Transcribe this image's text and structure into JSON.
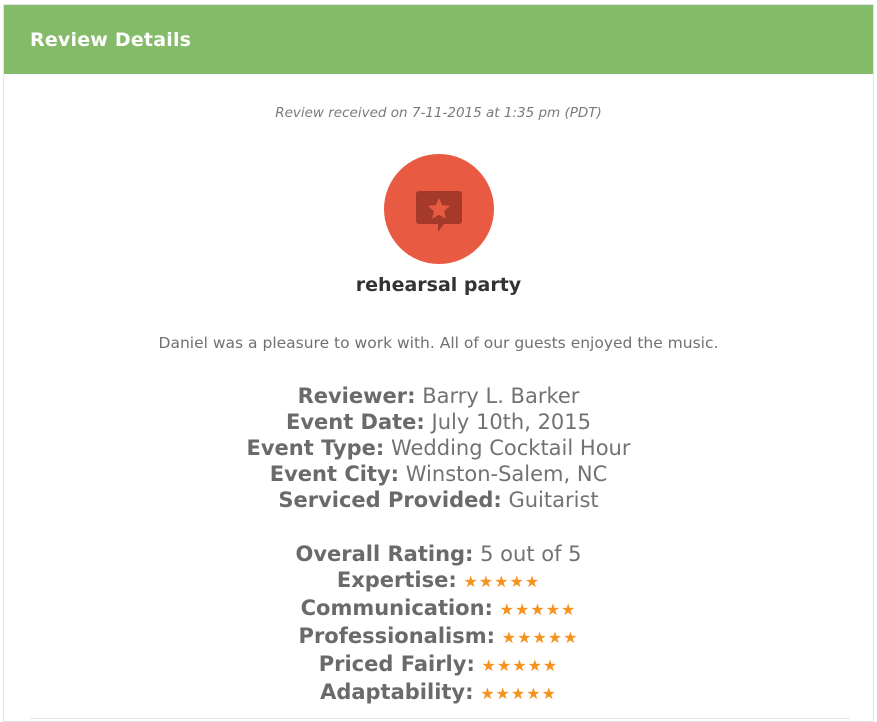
{
  "header": {
    "title": "Review Details",
    "background_color": "#84bb68"
  },
  "review": {
    "received": "Review received on 7-11-2015 at 1:35 pm (PDT)",
    "badge_icon": "star-speech-bubble-icon",
    "badge_color": "#e95a43",
    "title": "rehearsal party",
    "comment": "Daniel was a pleasure to work with. All of our guests enjoyed the music."
  },
  "details": {
    "reviewer_label": "Reviewer:",
    "reviewer_value": "Barry L. Barker",
    "event_date_label": "Event Date:",
    "event_date_value": "July 10th, 2015",
    "event_type_label": "Event Type:",
    "event_type_value": "Wedding Cocktail Hour",
    "event_city_label": "Event City:",
    "event_city_value": "Winston-Salem, NC",
    "service_label": "Serviced Provided:",
    "service_value": "Guitarist"
  },
  "ratings": {
    "overall_label": "Overall Rating:",
    "overall_value": "5 out of 5",
    "star_color": "#f6921e",
    "items": [
      {
        "label": "Expertise:",
        "stars": "★★★★★",
        "score": 5
      },
      {
        "label": "Communication:",
        "stars": "★★★★★",
        "score": 5
      },
      {
        "label": "Professionalism:",
        "stars": "★★★★★",
        "score": 5
      },
      {
        "label": "Priced Fairly:",
        "stars": "★★★★★",
        "score": 5
      },
      {
        "label": "Adaptability:",
        "stars": "★★★★★",
        "score": 5
      }
    ]
  }
}
